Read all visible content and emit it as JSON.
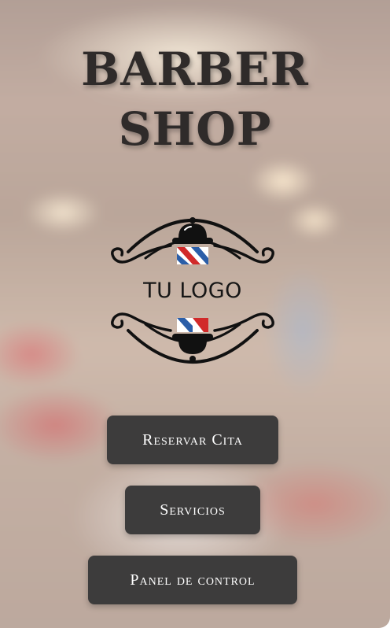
{
  "title": {
    "line1": "BARBER",
    "line2": "SHOP"
  },
  "logo": {
    "text": "TU LOGO",
    "icon": "barber-pole-emblem-icon"
  },
  "buttons": {
    "book": "Reservar Cita",
    "services": "Servicios",
    "dashboard": "Panel de control"
  },
  "colors": {
    "button_bg": "#3d3c3c",
    "button_text": "#ffffff",
    "title": "#2f2b2a",
    "pole_red": "#d12a2a",
    "pole_blue": "#2b5ea8"
  }
}
